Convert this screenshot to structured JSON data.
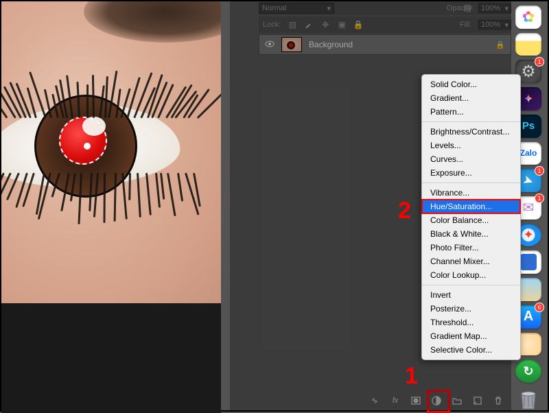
{
  "layersPanel": {
    "blendMode": "Normal",
    "opacityLabel": "Opacity:",
    "opacityValue": "100%",
    "lockLabel": "Lock:",
    "fillLabel": "Fill:",
    "fillValue": "100%",
    "layer": {
      "name": "Background"
    }
  },
  "adjustmentMenu": {
    "s1": [
      "Solid Color...",
      "Gradient...",
      "Pattern..."
    ],
    "s2": [
      "Brightness/Contrast...",
      "Levels...",
      "Curves...",
      "Exposure..."
    ],
    "s3": [
      "Vibrance...",
      "Hue/Saturation...",
      "Color Balance...",
      "Black & White...",
      "Photo Filter...",
      "Channel Mixer...",
      "Color Lookup..."
    ],
    "s4": [
      "Invert",
      "Posterize...",
      "Threshold...",
      "Gradient Map...",
      "Selective Color..."
    ],
    "selected": "Hue/Saturation..."
  },
  "annotations": {
    "callout1": "1",
    "callout2": "2"
  },
  "dock": {
    "apps": [
      {
        "id": "photos",
        "badge": null
      },
      {
        "id": "notes",
        "badge": null
      },
      {
        "id": "settings",
        "badge": "1"
      },
      {
        "id": "fcpx",
        "badge": null
      },
      {
        "id": "ps",
        "label": "Ps",
        "badge": null
      },
      {
        "id": "zalo",
        "label": "Zalo",
        "badge": null
      },
      {
        "id": "telegram",
        "badge": "1"
      },
      {
        "id": "messenger",
        "badge": "1"
      },
      {
        "id": "safari",
        "badge": null
      },
      {
        "id": "a",
        "badge": null
      },
      {
        "id": "b",
        "badge": null
      },
      {
        "id": "appstore",
        "badge": "6"
      },
      {
        "id": "light",
        "badge": null
      },
      {
        "id": "green",
        "badge": null
      },
      {
        "id": "trash",
        "badge": null
      }
    ]
  }
}
